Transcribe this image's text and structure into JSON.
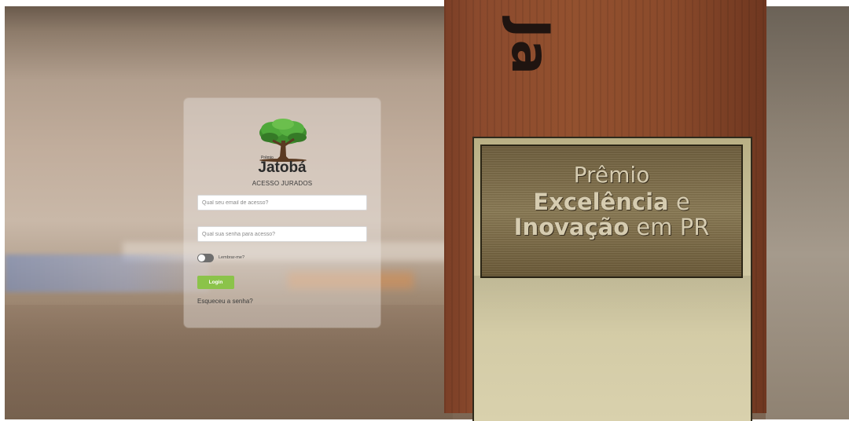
{
  "background": {
    "wood_lettering": "Ja",
    "plaque": {
      "line1": "Prêmio",
      "line2_bold": "Excelência",
      "line2_rest": " e",
      "line3_bold": "Inovação",
      "line3_rest": " em PR"
    }
  },
  "login_card": {
    "brand_small": "Prêmio",
    "brand": "Jatobá",
    "subtitle": "ACESSO JURADOS",
    "email_placeholder": "Qual seu email de acesso?",
    "email_value": "",
    "password_placeholder": "Qual sua senha para acesso?",
    "password_value": "",
    "remember_label": "Lembrar-me?",
    "remember_checked": false,
    "login_button": "Login",
    "forgot_link": "Esqueceu a senha?"
  },
  "colors": {
    "login_button": "#8bc34a",
    "card_background": "rgba(236,232,229,0.42)",
    "toggle_off": "#6e6e6e"
  },
  "icons": {
    "logo": "jatoba-tree-logo"
  }
}
